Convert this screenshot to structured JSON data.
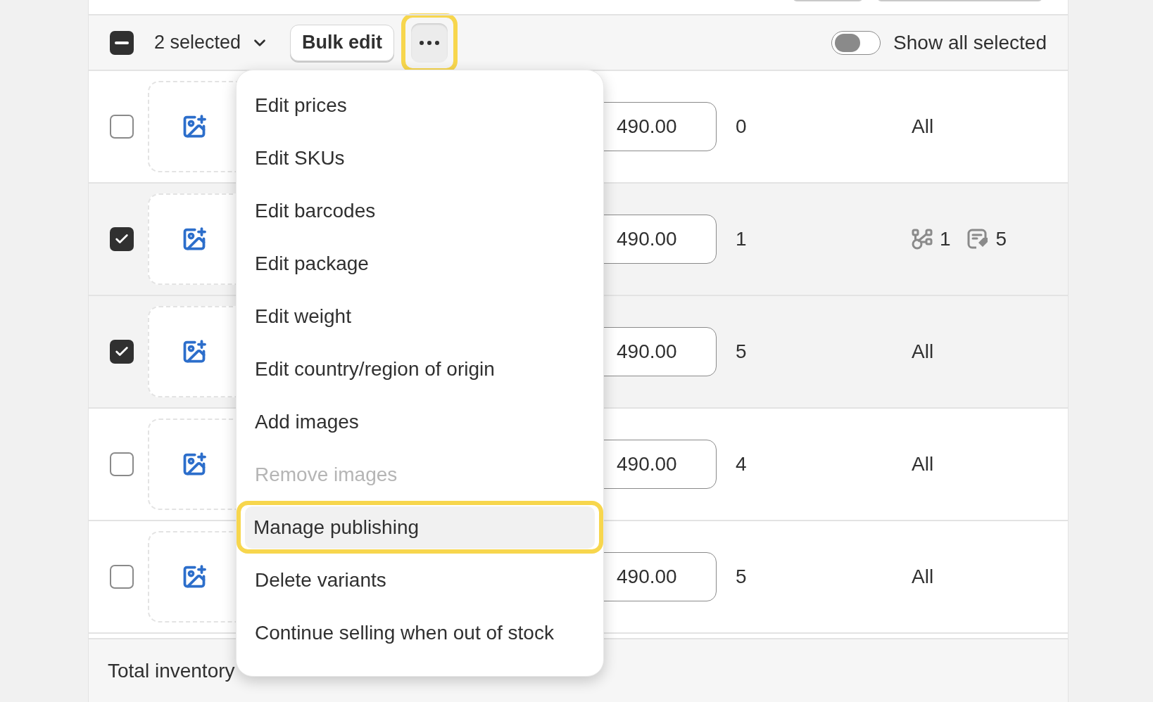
{
  "bulk_bar": {
    "select_all": {
      "indeterminate": true
    },
    "selected_label": "2 selected",
    "bulk_edit": "Bulk edit",
    "more_button": {
      "highlighted": true
    },
    "show_all": {
      "label": "Show all selected",
      "on": false
    }
  },
  "rows": [
    {
      "checked": false,
      "price": "490.00",
      "quantity": "0",
      "availability": {
        "kind": "text",
        "text": "All"
      }
    },
    {
      "checked": true,
      "price": "490.00",
      "quantity": "1",
      "availability": {
        "kind": "counts",
        "channels": "1",
        "catalogs": "5"
      }
    },
    {
      "checked": true,
      "price": "490.00",
      "quantity": "5",
      "availability": {
        "kind": "text",
        "text": "All"
      }
    },
    {
      "checked": false,
      "price": "490.00",
      "quantity": "4",
      "availability": {
        "kind": "text",
        "text": "All"
      }
    },
    {
      "checked": false,
      "price": "490.00",
      "quantity": "5",
      "availability": {
        "kind": "text",
        "text": "All"
      }
    }
  ],
  "footer": {
    "text": "Total inventory"
  },
  "menu": [
    {
      "label": "Edit prices",
      "disabled": false,
      "highlighted": false
    },
    {
      "label": "Edit SKUs",
      "disabled": false,
      "highlighted": false
    },
    {
      "label": "Edit barcodes",
      "disabled": false,
      "highlighted": false
    },
    {
      "label": "Edit package",
      "disabled": false,
      "highlighted": false
    },
    {
      "label": "Edit weight",
      "disabled": false,
      "highlighted": false
    },
    {
      "label": "Edit country/region of origin",
      "disabled": false,
      "highlighted": false
    },
    {
      "label": "Add images",
      "disabled": false,
      "highlighted": false
    },
    {
      "label": "Remove images",
      "disabled": true,
      "highlighted": false
    },
    {
      "label": "Manage publishing",
      "disabled": false,
      "highlighted": true
    },
    {
      "label": "Delete variants",
      "disabled": false,
      "highlighted": false
    },
    {
      "label": "Continue selling when out of stock",
      "disabled": false,
      "highlighted": false
    }
  ]
}
